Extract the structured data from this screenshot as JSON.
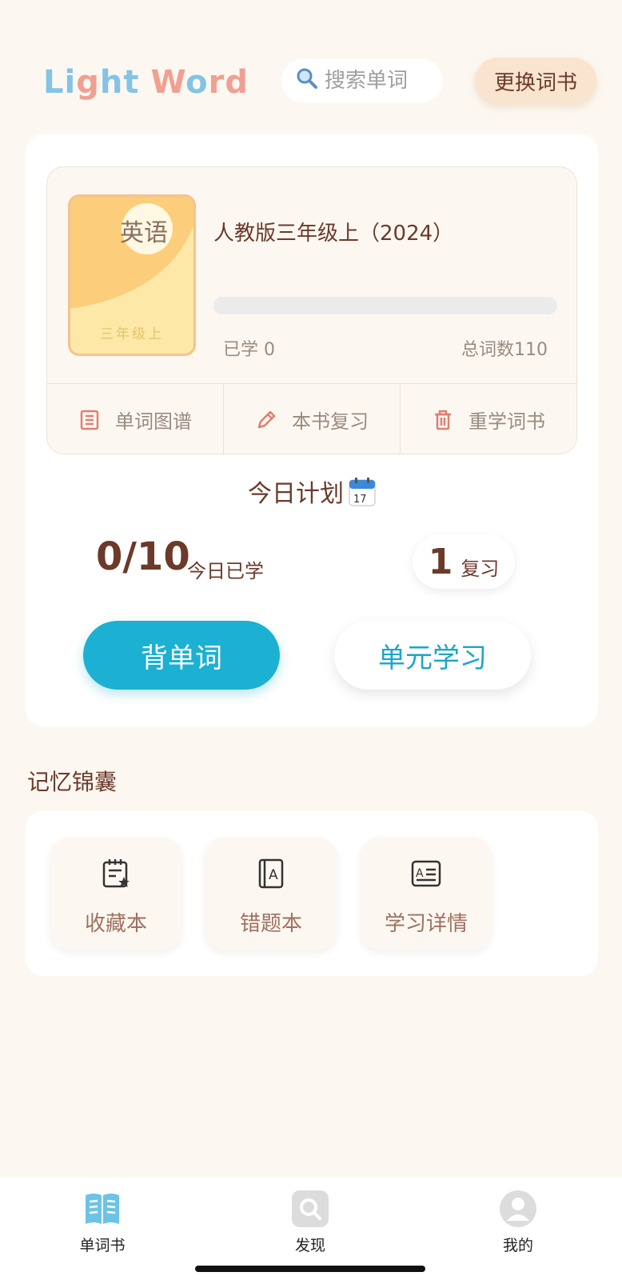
{
  "header": {
    "logo_word1_part1": "Li",
    "logo_word1_part2": "g",
    "logo_word1_part3": "ht",
    "logo_word2_part1": "W",
    "logo_word2_part2": "o",
    "logo_word2_part3": "rd",
    "search_placeholder": "搜索单词",
    "change_book_label": "更换词书"
  },
  "book": {
    "cover_title": "英语",
    "cover_grade": "三年级上",
    "title": "人教版三年级上（2024）",
    "progress": 0,
    "learned_label": "已学 0",
    "total_label": "总词数110",
    "actions": [
      {
        "label": "单词图谱",
        "icon": "list-icon"
      },
      {
        "label": "本书复习",
        "icon": "pencil-icon"
      },
      {
        "label": "重学词书",
        "icon": "trash-icon"
      }
    ]
  },
  "plan": {
    "title": "今日计划",
    "today_count": "0/10",
    "today_label": "今日已学",
    "review_count": "1",
    "review_label": "复习",
    "primary_button": "背单词",
    "secondary_button": "单元学习"
  },
  "memory": {
    "title": "记忆锦囊",
    "tiles": [
      {
        "label": "收藏本",
        "icon": "notebook-star-icon"
      },
      {
        "label": "错题本",
        "icon": "book-a-icon"
      },
      {
        "label": "学习详情",
        "icon": "document-list-icon"
      }
    ]
  },
  "nav": {
    "items": [
      {
        "label": "单词书",
        "icon": "open-book-icon",
        "active": true
      },
      {
        "label": "发现",
        "icon": "search-icon",
        "active": false
      },
      {
        "label": "我的",
        "icon": "profile-icon",
        "active": false
      }
    ]
  },
  "colors": {
    "accent": "#1cb0d2",
    "background": "#fcf8f1",
    "text_brown": "#6b3a2a",
    "logo_blue": "#85c3e6",
    "logo_pink": "#f0a092"
  }
}
